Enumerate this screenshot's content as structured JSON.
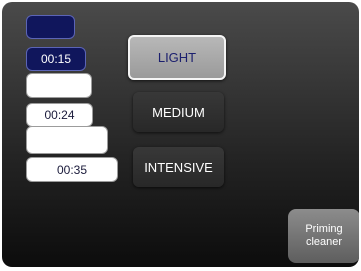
{
  "time_slots": [
    {
      "value": "",
      "style": "dark"
    },
    {
      "value": "00:15",
      "style": "dark"
    },
    {
      "value": "",
      "style": "light"
    },
    {
      "value": "00:24",
      "style": "light"
    },
    {
      "value": "",
      "style": "light"
    },
    {
      "value": "00:35",
      "style": "light"
    }
  ],
  "modes": [
    {
      "label": "LIGHT",
      "selected": true
    },
    {
      "label": "MEDIUM",
      "selected": false
    },
    {
      "label": "INTENSIVE",
      "selected": false
    }
  ],
  "priming_button": {
    "label": "Priming cleaner"
  },
  "colors": {
    "slot_dark": "#10165c",
    "slot_light": "#ffffff",
    "selected_text": "#1b1f6e"
  }
}
